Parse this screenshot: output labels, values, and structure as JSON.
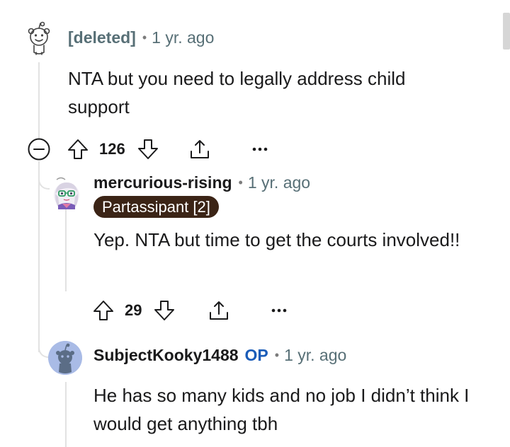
{
  "comments": [
    {
      "username": "[deleted]",
      "time": "1 yr. ago",
      "body": "NTA but you need to legally address child support",
      "score": "126",
      "icons": {
        "avatar": "reddit-snoo-outline-icon",
        "collapse": "collapse-minus-icon",
        "upvote": "arrow-up-icon",
        "downvote": "arrow-down-icon",
        "share": "share-icon",
        "more": "more-horizontal-icon"
      }
    },
    {
      "username": "mercurious-rising",
      "time": "1 yr. ago",
      "flair": "Partassipant [2]",
      "flair_color": "#3b2416",
      "body": "Yep. NTA but time to get the courts involved!!",
      "score": "29",
      "icons": {
        "avatar": "anime-character-avatar-icon",
        "upvote": "arrow-up-icon",
        "downvote": "arrow-down-icon",
        "share": "share-icon",
        "more": "more-horizontal-icon"
      }
    },
    {
      "username": "SubjectKooky1488",
      "op_label": "OP",
      "op_color": "#1a5cb8",
      "time": "1 yr. ago",
      "body": "He has so many kids and no job I didn’t think I would get anything tbh",
      "icons": {
        "avatar": "reddit-snoo-avatar-icon"
      }
    }
  ],
  "separator": "•"
}
